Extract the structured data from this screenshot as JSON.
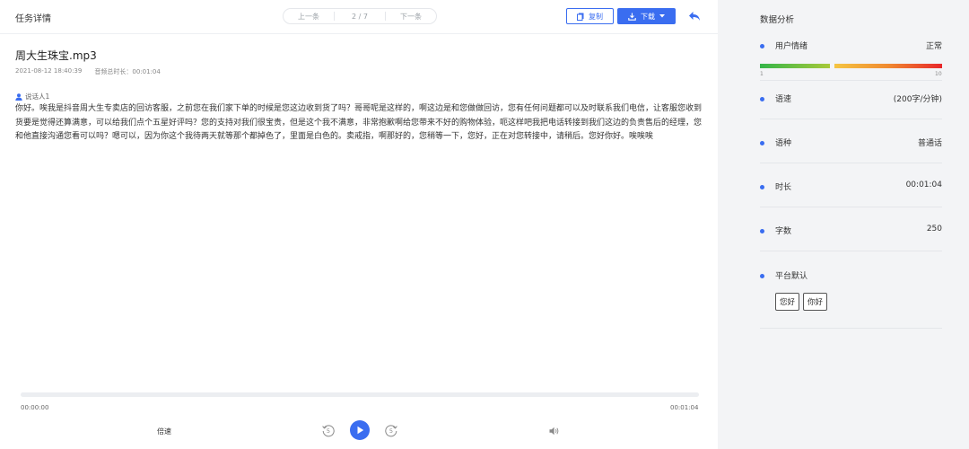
{
  "header": {
    "title": "任务详情",
    "pager": {
      "prev": "上一条",
      "position": "2 / 7",
      "next": "下一条"
    },
    "copy_label": "复制",
    "download_label": "下载"
  },
  "file": {
    "name": "周大生珠宝.mp3",
    "datetime": "2021-08-12 18:40:39",
    "duration_label": "音频总时长：00:01:04"
  },
  "transcript": {
    "speaker": "说话人1",
    "text": "你好。唉我是抖音周大生专卖店的回访客服，之前您在我们家下单的时候是您这边收到货了吗？哥哥呢是这样的，啊这边是和您做做回访，您有任何问题都可以及时联系我们电信，让客服您收到货要是觉得还算满意，可以给我们点个五星好评吗？您的支持对我们很宝贵，但是这个我不满意，非常抱歉啊给您带来不好的购物体验，呃这样吧我把电话转接到我们这边的负责售后的经理，您和他直接沟通您看可以吗？嗯可以，因为你这个我待两天就等那个都掉色了，里面是白色的。卖戒指，啊那好的，您稍等一下，您好，正在对您转接中，请稍后。您好你好。唉唉唉"
  },
  "player": {
    "time_start": "00:00:00",
    "time_end": "00:01:04",
    "speed_label": "倍速",
    "progress": 0
  },
  "analysis": {
    "title": "数据分析",
    "emotion": {
      "label": "用户情绪",
      "value": "正常",
      "scale_min": "1",
      "scale_max": "10"
    },
    "speed": {
      "label": "语速",
      "value": "(200字/分钟)"
    },
    "language": {
      "label": "语种",
      "value": "普通话"
    },
    "duration": {
      "label": "时长",
      "value": "00:01:04"
    },
    "word_count": {
      "label": "字数",
      "value": "250"
    },
    "platform": {
      "label": "平台默认",
      "tags": [
        "您好",
        "你好"
      ]
    }
  },
  "colors": {
    "accent": "#3a6df0"
  },
  "icons": [
    "back-icon",
    "copy-icon",
    "download-icon",
    "chevron-down-icon",
    "user-icon",
    "rewind-icon",
    "play-icon",
    "forward-icon",
    "volume-icon"
  ]
}
